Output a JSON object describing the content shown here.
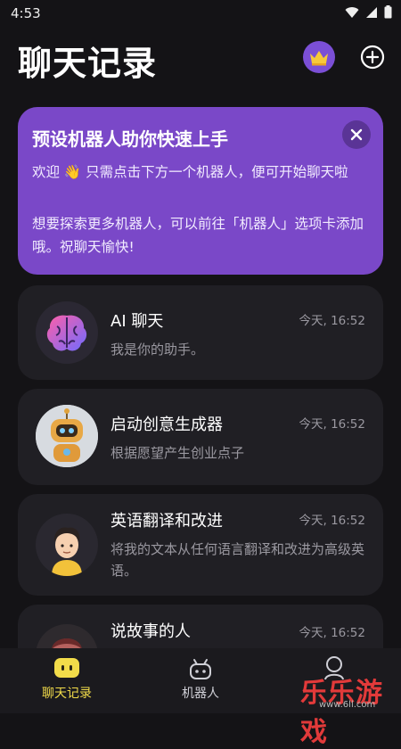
{
  "status": {
    "time": "4:53"
  },
  "header": {
    "title": "聊天记录"
  },
  "banner": {
    "title": "预设机器人助你快速上手",
    "line1": "欢迎 👋 只需点击下方一个机器人，便可开始聊天啦",
    "line2": "想要探索更多机器人，可以前往「机器人」选项卡添加哦。祝聊天愉快!"
  },
  "chats": [
    {
      "name": "AI 聊天",
      "desc": "我是你的助手。",
      "time": "今天, 16:52"
    },
    {
      "name": "启动创意生成器",
      "desc": "根据愿望产生创业点子",
      "time": "今天, 16:52"
    },
    {
      "name": "英语翻译和改进",
      "desc": "将我的文本从任何语言翻译和改进为高级英语。",
      "time": "今天, 16:52"
    },
    {
      "name": "说故事的人",
      "desc": "",
      "time": "今天, 16:52"
    }
  ],
  "tabs": [
    {
      "label": "聊天记录",
      "color": "#f2dc4a"
    },
    {
      "label": "机器人",
      "color": "#cfcfd6"
    },
    {
      "label": "",
      "color": "#cfcfd6"
    }
  ],
  "watermark": {
    "text": "乐乐游戏",
    "site": "www.6ll.com"
  }
}
